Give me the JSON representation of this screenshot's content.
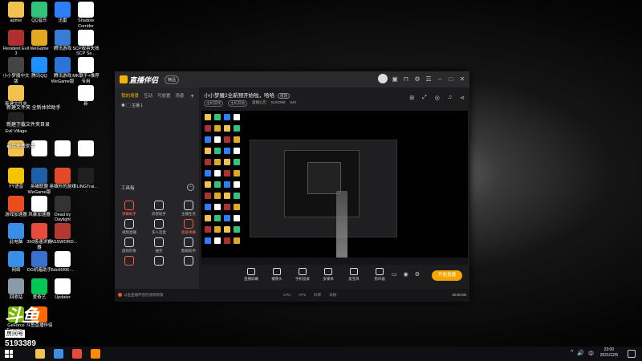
{
  "desktop_icons": [
    {
      "label": "admin",
      "color": "#f2c14e"
    },
    {
      "label": "QQ音乐",
      "color": "#31c27c"
    },
    {
      "label": "迅雷",
      "color": "#2d7ff9"
    },
    {
      "label": "Shadow Corridor",
      "color": "#ffffff"
    },
    {
      "label": "Resident Evil 3",
      "color": "#b03030"
    },
    {
      "label": "WeGame",
      "color": "#e3a820"
    },
    {
      "label": "腾讯游戏",
      "color": "#3a7bd5"
    },
    {
      "label": "SCP收容失效 SCP Se...",
      "color": "#ffffff"
    },
    {
      "label": "小小梦魇中文版",
      "color": "#444444"
    },
    {
      "label": "腾讯QQ",
      "color": "#1e90ff"
    },
    {
      "label": "腾讯游戏 WeGame版",
      "color": "#2c74d6"
    },
    {
      "label": "MK联手+推荐专用",
      "color": "#ffffff"
    },
    {
      "label": "新建文件夹",
      "color": "#f2c14e"
    },
    {
      "label": "",
      "color": "#000000"
    },
    {
      "label": "",
      "color": "#000000"
    },
    {
      "label": "新",
      "color": "#ffffff"
    },
    {
      "label": "Evil Village",
      "color": "#222222"
    },
    {
      "label": "",
      "color": "#000000"
    },
    {
      "label": "",
      "color": "#000000"
    },
    {
      "label": "",
      "color": "#000000"
    },
    {
      "label": "",
      "color": "#f2c14e"
    },
    {
      "label": "",
      "color": "#ffffff"
    },
    {
      "label": "",
      "color": "#ffffff"
    },
    {
      "label": "",
      "color": "#ffffff"
    },
    {
      "label": "YY语音",
      "color": "#f5c400"
    },
    {
      "label": "英雄联盟 WeGame版",
      "color": "#1f5fa8"
    },
    {
      "label": "英雄外的游戏",
      "color": "#e24b2a"
    },
    {
      "label": "FLiNGTrai...",
      "color": "#202020"
    },
    {
      "label": "游戏加速器",
      "color": "#e84d1c"
    },
    {
      "label": "风暴加速器",
      "color": "#ffffff"
    },
    {
      "label": "Dead by Daylight",
      "color": "#333333"
    },
    {
      "label": "",
      "color": "#000000"
    },
    {
      "label": "此电脑",
      "color": "#3a8ee6"
    },
    {
      "label": "360极速浏览器",
      "color": "#e84b3c"
    },
    {
      "label": "PASSWORD...",
      "color": "#b03a2e"
    },
    {
      "label": "",
      "color": "#000000"
    },
    {
      "label": "网络",
      "color": "#3a8ee6"
    },
    {
      "label": "DG机箱助手",
      "color": "#3a70d0"
    },
    {
      "label": "6dc66f96-...",
      "color": "#ffffff"
    },
    {
      "label": "",
      "color": "#000000"
    },
    {
      "label": "回收站",
      "color": "#8a9aa8"
    },
    {
      "label": "爱奇艺",
      "color": "#00c853"
    },
    {
      "label": "Updater",
      "color": "#ffffff"
    },
    {
      "label": "",
      "color": "#000000"
    },
    {
      "label": "GeForce Experie...",
      "color": "#76b900"
    },
    {
      "label": "斗鱼直播伴侣",
      "color": "#ff6a00"
    },
    {
      "label": "",
      "color": "#000000"
    },
    {
      "label": "",
      "color": "#000000"
    }
  ],
  "overlay_texts": [
    "新建文件夹 全新体验助手",
    "新建下载文件夹目录",
    "最佳免费助手"
  ],
  "room": {
    "logo": "斗鱼",
    "label": "房间号",
    "number": "5193389"
  },
  "app": {
    "brand": "直播伴侣",
    "version_pill": "精品",
    "tabs": [
      "我的场景",
      "互动",
      "可放置",
      "场景"
    ],
    "scene_item": "主播 1",
    "tools_header": "工具箱",
    "tools": [
      {
        "label": "弹幕助手",
        "hot": true
      },
      {
        "label": "房管助手",
        "hot": false
      },
      {
        "label": "主播任务",
        "hot": false
      },
      {
        "label": "视频直播",
        "hot": false
      },
      {
        "label": "多人连麦",
        "hot": false
      },
      {
        "label": "超级弹幕",
        "hot": true
      },
      {
        "label": "虚拟形象",
        "hot": false
      },
      {
        "label": "抽奖",
        "hot": false
      },
      {
        "label": "数据助手",
        "hot": false
      },
      {
        "label": "",
        "hot": true
      },
      {
        "label": "",
        "hot": false
      },
      {
        "label": "",
        "hot": false
      }
    ],
    "room_title": "小小梦魇2全新预开始啦，哈哈",
    "room_title_tag": "修改",
    "meta": {
      "category": "主机游戏",
      "channel": "主机其他",
      "notice": "直播公告",
      "room_id": "5193389",
      "viewers": "940"
    },
    "controls": [
      {
        "label": "直播屏幕"
      },
      {
        "label": "摄像头"
      },
      {
        "label": "手机投屏"
      },
      {
        "label": "多媒体"
      },
      {
        "label": "麦克风"
      },
      {
        "label": "扬声器"
      }
    ],
    "go_live": "开始直播",
    "status": {
      "warning": "斗鱼直播伴侣检测到新版",
      "cpu": "CPU",
      "fps": "FPS",
      "bitrate": "码率",
      "drop": "丢帧",
      "timer": "00:00:00"
    }
  },
  "taskbar": {
    "apps": [
      {
        "name": "file-explorer",
        "color": "#f2c14e"
      },
      {
        "name": "store",
        "color": "#3a8ee6"
      },
      {
        "name": "chrome",
        "color": "#e84b3c"
      },
      {
        "name": "douyu",
        "color": "#ff8a00"
      }
    ],
    "tray": [
      "^",
      "🔊",
      "中"
    ],
    "time": "23:00",
    "date": "2021/12/5"
  }
}
